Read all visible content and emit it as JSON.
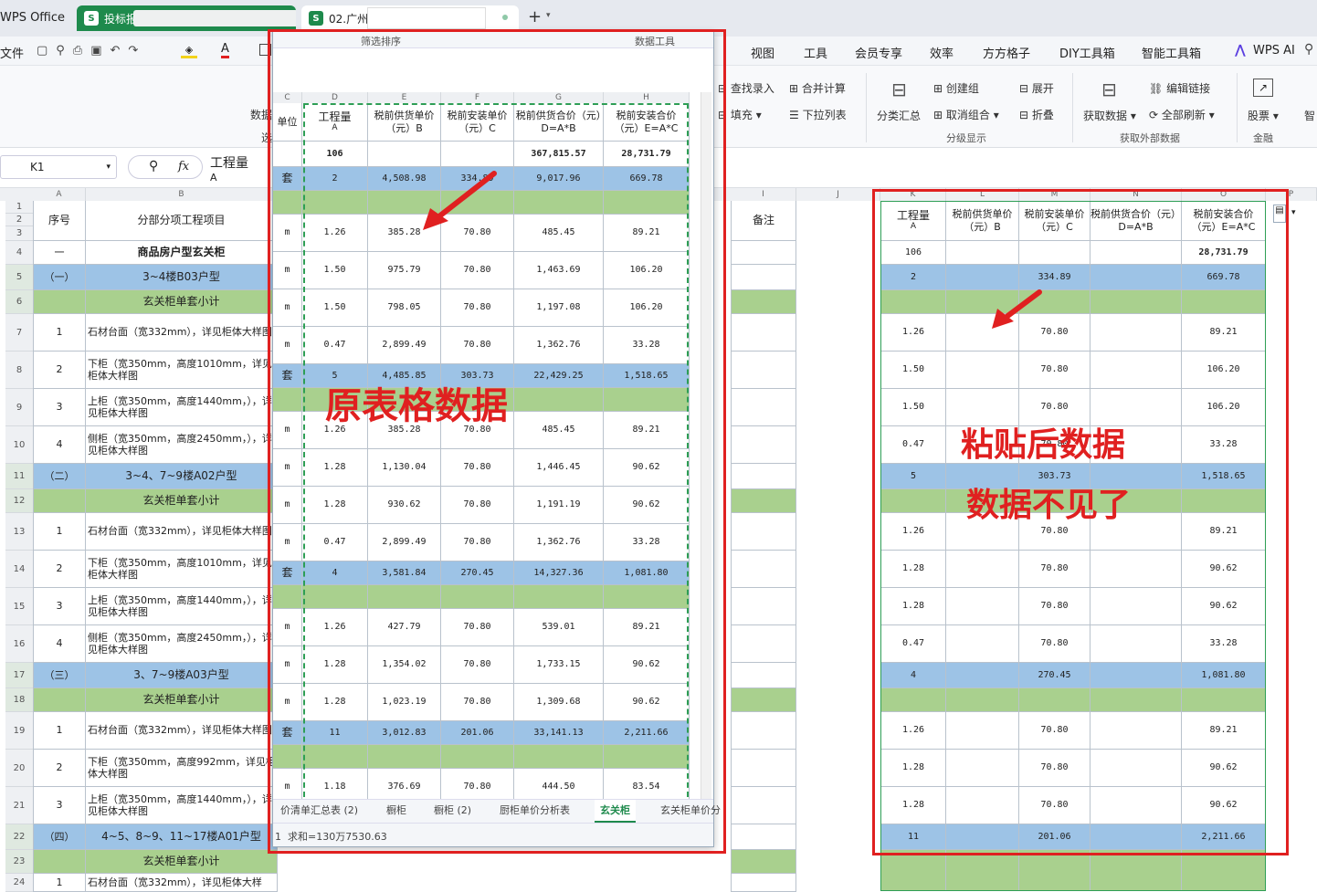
{
  "tabbar": {
    "app_label": "WPS Office",
    "tab1_label": "投标报",
    "tab2_label": "02.广州方",
    "add_symbol": "+"
  },
  "menu": {
    "file": "文件",
    "items": [
      "视图",
      "工具",
      "会员专享",
      "效率",
      "方方格子",
      "DIY工具箱",
      "智能工具箱"
    ],
    "ai": "WPS AI"
  },
  "ribbon": {
    "find_entry": "查找录入",
    "merge_calc": "合并计算",
    "fill": "填充",
    "dropdown_list": "下拉列表",
    "subtotal": "分类汇总",
    "create_group": "创建组",
    "ungroup": "取消组合",
    "expand": "展开",
    "collapse": "折叠",
    "group_label": "分级显示",
    "get_data": "获取数据",
    "edit_links": "编辑链接",
    "refresh_all": "全部刷新",
    "external_label": "获取外部数据",
    "stock": "股票",
    "finance_label": "金融",
    "smart": "智",
    "data_truncated": "数据",
    "sort_truncated": "选"
  },
  "formula": {
    "cell_ref": "K1",
    "fx": "fx",
    "value": "工程量",
    "value_line2": "A"
  },
  "sheet_left": {
    "headers": {
      "seq": "序号",
      "item": "分部分项工程项目",
      "remark": "备注"
    },
    "rows": [
      {
        "r": "4",
        "a": "一",
        "b": "商品房户型玄关柜",
        "type": "title"
      },
      {
        "r": "5",
        "a": "（一）",
        "b": "3~4楼B03户型",
        "type": "blue"
      },
      {
        "r": "6",
        "a": "",
        "b": "玄关柜单套小计",
        "type": "green"
      },
      {
        "r": "7",
        "a": "1",
        "b": "石材台面（宽332mm），详见柜体大样图",
        "type": "item"
      },
      {
        "r": "8",
        "a": "2",
        "b": "下柜（宽350mm，高度1010mm，详见柜体大样图",
        "type": "item"
      },
      {
        "r": "9",
        "a": "3",
        "b": "上柜（宽350mm，高度1440mm，），详见柜体大样图",
        "type": "item"
      },
      {
        "r": "10",
        "a": "4",
        "b": "侧柜（宽350mm，高度2450mm，），详见柜体大样图",
        "type": "item"
      },
      {
        "r": "11",
        "a": "（二）",
        "b": "3~4、7~9楼A02户型",
        "type": "blue"
      },
      {
        "r": "12",
        "a": "",
        "b": "玄关柜单套小计",
        "type": "green"
      },
      {
        "r": "13",
        "a": "1",
        "b": "石材台面（宽332mm），详见柜体大样图",
        "type": "item"
      },
      {
        "r": "14",
        "a": "2",
        "b": "下柜（宽350mm，高度1010mm，详见柜体大样图",
        "type": "item"
      },
      {
        "r": "15",
        "a": "3",
        "b": "上柜（宽350mm，高度1440mm，），详见柜体大样图",
        "type": "item"
      },
      {
        "r": "16",
        "a": "4",
        "b": "侧柜（宽350mm，高度2450mm，），详见柜体大样图",
        "type": "item"
      },
      {
        "r": "17",
        "a": "（三）",
        "b": "3、7~9楼A03户型",
        "type": "blue"
      },
      {
        "r": "18",
        "a": "",
        "b": "玄关柜单套小计",
        "type": "green"
      },
      {
        "r": "19",
        "a": "1",
        "b": "石材台面（宽332mm），详见柜体大样图",
        "type": "item"
      },
      {
        "r": "20",
        "a": "2",
        "b": "下柜（宽350mm，高度992mm，详见柜体大样图",
        "type": "item"
      },
      {
        "r": "21",
        "a": "3",
        "b": "上柜（宽350mm，高度1440mm，），详见柜体大样图",
        "type": "item"
      },
      {
        "r": "22",
        "a": "（四）",
        "b": "4~5、8~9、11~17楼A01户型",
        "type": "blue"
      },
      {
        "r": "23",
        "a": "",
        "b": "玄关柜单套小计",
        "type": "green"
      },
      {
        "r": "24",
        "a": "1",
        "b": "石材台面（宽332mm），详见柜体大样",
        "type": "item"
      }
    ]
  },
  "popup": {
    "toolbar_left": "筛选排序",
    "toolbar_right": "数据工具",
    "col_letters": [
      "C",
      "D",
      "E",
      "F",
      "G",
      "H"
    ],
    "headers": {
      "unit": "单位",
      "qty": "工程量",
      "qty_sub": "A",
      "supply": "税前供货单价（元）B",
      "install": "税前安装单价（元）C",
      "supply_total": "税前供货合价（元）D=A*B",
      "install_total": "税前安装合价（元）E=A*C"
    },
    "rows": [
      {
        "u": "",
        "q": "106",
        "b": "",
        "c": "",
        "d": "367,815.57",
        "e": "28,731.79",
        "t": "total"
      },
      {
        "u": "套",
        "q": "2",
        "b": "4,508.98",
        "c": "334.89",
        "d": "9,017.96",
        "e": "669.78",
        "t": "blue"
      },
      {
        "u": "",
        "q": "",
        "b": "",
        "c": "",
        "d": "",
        "e": "",
        "t": "green"
      },
      {
        "u": "m",
        "q": "1.26",
        "b": "385.28",
        "c": "70.80",
        "d": "485.45",
        "e": "89.21",
        "t": "item"
      },
      {
        "u": "m",
        "q": "1.50",
        "b": "975.79",
        "c": "70.80",
        "d": "1,463.69",
        "e": "106.20",
        "t": "item"
      },
      {
        "u": "m",
        "q": "1.50",
        "b": "798.05",
        "c": "70.80",
        "d": "1,197.08",
        "e": "106.20",
        "t": "item"
      },
      {
        "u": "m",
        "q": "0.47",
        "b": "2,899.49",
        "c": "70.80",
        "d": "1,362.76",
        "e": "33.28",
        "t": "item"
      },
      {
        "u": "套",
        "q": "5",
        "b": "4,485.85",
        "c": "303.73",
        "d": "22,429.25",
        "e": "1,518.65",
        "t": "blue"
      },
      {
        "u": "",
        "q": "",
        "b": "",
        "c": "",
        "d": "",
        "e": "",
        "t": "green"
      },
      {
        "u": "m",
        "q": "1.26",
        "b": "385.28",
        "c": "70.80",
        "d": "485.45",
        "e": "89.21",
        "t": "item"
      },
      {
        "u": "m",
        "q": "1.28",
        "b": "1,130.04",
        "c": "70.80",
        "d": "1,446.45",
        "e": "90.62",
        "t": "item"
      },
      {
        "u": "m",
        "q": "1.28",
        "b": "930.62",
        "c": "70.80",
        "d": "1,191.19",
        "e": "90.62",
        "t": "item"
      },
      {
        "u": "m",
        "q": "0.47",
        "b": "2,899.49",
        "c": "70.80",
        "d": "1,362.76",
        "e": "33.28",
        "t": "item"
      },
      {
        "u": "套",
        "q": "4",
        "b": "3,581.84",
        "c": "270.45",
        "d": "14,327.36",
        "e": "1,081.80",
        "t": "blue"
      },
      {
        "u": "",
        "q": "",
        "b": "",
        "c": "",
        "d": "",
        "e": "",
        "t": "green"
      },
      {
        "u": "m",
        "q": "1.26",
        "b": "427.79",
        "c": "70.80",
        "d": "539.01",
        "e": "89.21",
        "t": "item"
      },
      {
        "u": "m",
        "q": "1.28",
        "b": "1,354.02",
        "c": "70.80",
        "d": "1,733.15",
        "e": "90.62",
        "t": "item"
      },
      {
        "u": "m",
        "q": "1.28",
        "b": "1,023.19",
        "c": "70.80",
        "d": "1,309.68",
        "e": "90.62",
        "t": "item"
      },
      {
        "u": "套",
        "q": "11",
        "b": "3,012.83",
        "c": "201.06",
        "d": "33,141.13",
        "e": "2,211.66",
        "t": "blue"
      },
      {
        "u": "",
        "q": "",
        "b": "",
        "c": "",
        "d": "",
        "e": "",
        "t": "green"
      },
      {
        "u": "m",
        "q": "1.18",
        "b": "376.69",
        "c": "70.80",
        "d": "444.50",
        "e": "83.54",
        "t": "item"
      }
    ],
    "sheet_tabs": [
      "价清单汇总表 (2)",
      "橱柜",
      "橱柜 (2)",
      "厨柜单价分析表",
      "玄关柜",
      "玄关柜单价分"
    ],
    "active_tab": 4,
    "status": "求和=130万7530.63",
    "status_prefix": "1"
  },
  "pasted": {
    "col_letters": [
      "K",
      "L",
      "M",
      "N",
      "O",
      "P"
    ],
    "headers": {
      "qty": "工程量",
      "qty_sub": "A",
      "supply": "税前供货单价（元）B",
      "install": "税前安装单价（元）C",
      "supply_total": "税前供货合价（元）D=A*B",
      "install_total": "税前安装合价（元）E=A*C"
    },
    "rows": [
      {
        "q": "106",
        "b": "",
        "c": "",
        "d": "",
        "e": "28,731.79",
        "t": "total"
      },
      {
        "q": "2",
        "b": "",
        "c": "334.89",
        "d": "",
        "e": "669.78",
        "t": "blue"
      },
      {
        "q": "",
        "b": "",
        "c": "",
        "d": "",
        "e": "",
        "t": "green"
      },
      {
        "q": "1.26",
        "b": "",
        "c": "70.80",
        "d": "",
        "e": "89.21",
        "t": "item"
      },
      {
        "q": "1.50",
        "b": "",
        "c": "70.80",
        "d": "",
        "e": "106.20",
        "t": "item"
      },
      {
        "q": "1.50",
        "b": "",
        "c": "70.80",
        "d": "",
        "e": "106.20",
        "t": "item"
      },
      {
        "q": "0.47",
        "b": "",
        "c": "70.80",
        "d": "",
        "e": "33.28",
        "t": "item"
      },
      {
        "q": "5",
        "b": "",
        "c": "303.73",
        "d": "",
        "e": "1,518.65",
        "t": "blue"
      },
      {
        "q": "",
        "b": "",
        "c": "",
        "d": "",
        "e": "",
        "t": "green"
      },
      {
        "q": "1.26",
        "b": "",
        "c": "70.80",
        "d": "",
        "e": "89.21",
        "t": "item"
      },
      {
        "q": "1.28",
        "b": "",
        "c": "70.80",
        "d": "",
        "e": "90.62",
        "t": "item"
      },
      {
        "q": "1.28",
        "b": "",
        "c": "70.80",
        "d": "",
        "e": "90.62",
        "t": "item"
      },
      {
        "q": "0.47",
        "b": "",
        "c": "70.80",
        "d": "",
        "e": "33.28",
        "t": "item"
      },
      {
        "q": "4",
        "b": "",
        "c": "270.45",
        "d": "",
        "e": "1,081.80",
        "t": "blue"
      },
      {
        "q": "",
        "b": "",
        "c": "",
        "d": "",
        "e": "",
        "t": "green"
      },
      {
        "q": "1.26",
        "b": "",
        "c": "70.80",
        "d": "",
        "e": "89.21",
        "t": "item"
      },
      {
        "q": "1.28",
        "b": "",
        "c": "70.80",
        "d": "",
        "e": "90.62",
        "t": "item"
      },
      {
        "q": "1.28",
        "b": "",
        "c": "70.80",
        "d": "",
        "e": "90.62",
        "t": "item"
      },
      {
        "q": "11",
        "b": "",
        "c": "201.06",
        "d": "",
        "e": "2,211.66",
        "t": "blue"
      }
    ]
  },
  "annotations": {
    "original": "原表格数据",
    "pasted": "粘贴后数据",
    "missing": "数据不见了"
  },
  "colors": {
    "blue_row": "#9dc3e6",
    "green_row": "#a9d08e",
    "red": "#e02020",
    "accent": "#1e8a4c"
  }
}
